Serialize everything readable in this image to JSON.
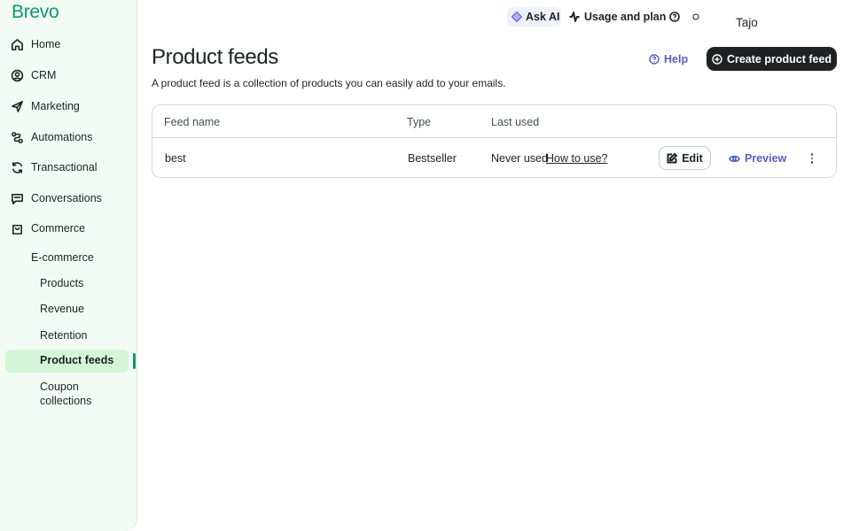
{
  "app": {
    "logo": "Brevo"
  },
  "sidebar": {
    "items": [
      {
        "label": "Home",
        "icon": "home-icon"
      },
      {
        "label": "CRM",
        "icon": "contacts-icon"
      },
      {
        "label": "Marketing",
        "icon": "send-icon"
      },
      {
        "label": "Automations",
        "icon": "automation-icon"
      },
      {
        "label": "Transactional",
        "icon": "refresh-icon"
      },
      {
        "label": "Conversations",
        "icon": "chat-icon"
      },
      {
        "label": "Commerce",
        "icon": "shopping-bag-icon"
      }
    ],
    "commerce_sub": {
      "ecommerce": "E-commerce",
      "products": "Products",
      "revenue": "Revenue",
      "retention": "Retention",
      "product_feeds": "Product feeds",
      "coupon_collections": "Coupon collections"
    }
  },
  "topbar": {
    "ask_ai": "Ask AI",
    "usage_plan": "Usage and plan",
    "user_name": "Tajo"
  },
  "header": {
    "title": "Product feeds",
    "description": "A product feed is a collection of products you can easily add to your emails.",
    "help_label": "Help",
    "create_label": "Create product feed"
  },
  "table": {
    "columns": [
      "Feed name",
      "Type",
      "Last used"
    ],
    "rows": [
      {
        "name": "best",
        "type": "Bestseller",
        "last_used": "Never used",
        "how_to": "How to use?",
        "edit_label": "Edit",
        "preview_label": "Preview"
      }
    ]
  },
  "colors": {
    "brand": "#0b996e",
    "sidebar_bg": "#f2fcf4",
    "active_bg": "#d4f6d6",
    "link": "#5460c5",
    "primary_button": "#1f2223"
  }
}
